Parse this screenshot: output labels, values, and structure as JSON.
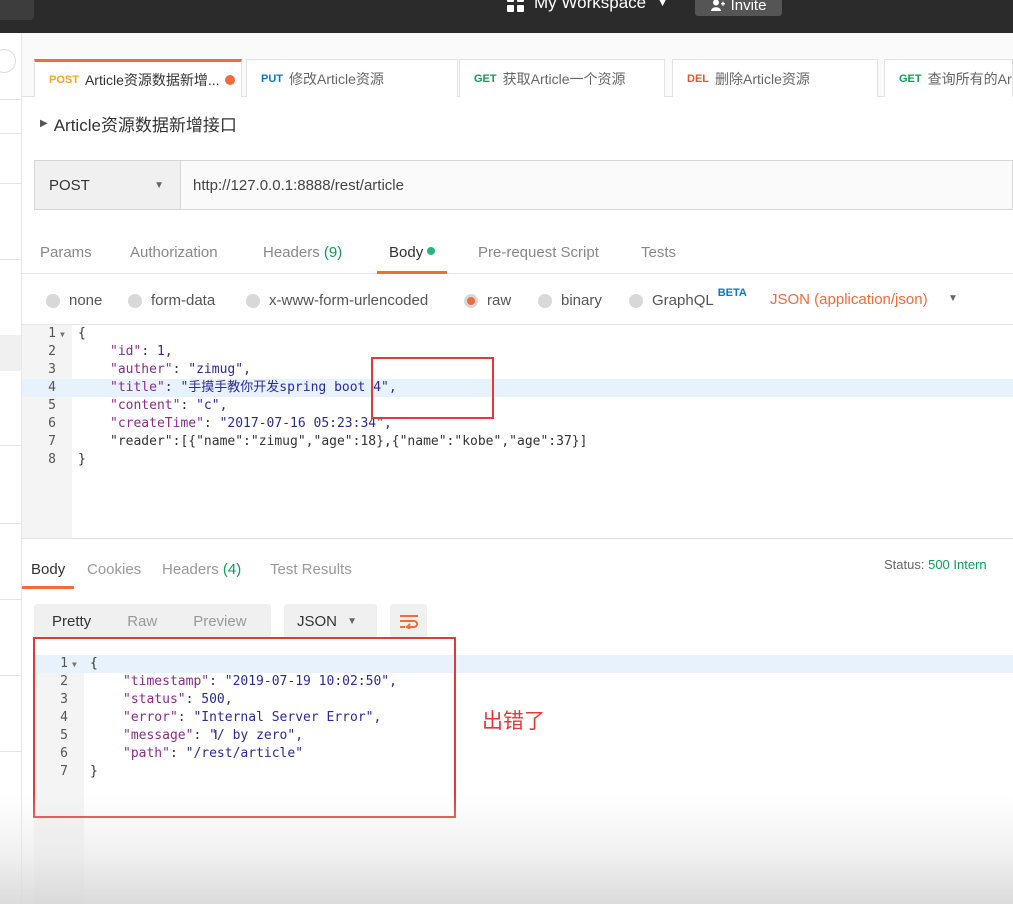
{
  "topbar": {
    "workspace": "My Workspace",
    "invite": "Invite"
  },
  "request_tabs": [
    {
      "method": "POST",
      "label": "Article资源数据新增..."
    },
    {
      "method": "PUT",
      "label": "修改Article资源"
    },
    {
      "method": "GET",
      "label": "获取Article一个资源"
    },
    {
      "method": "DEL",
      "label": "删除Article资源"
    },
    {
      "method": "GET",
      "label": "查询所有的Art"
    }
  ],
  "request": {
    "name": "Article资源数据新增接口",
    "method": "POST",
    "url": "http://127.0.0.1:8888/rest/article"
  },
  "subtabs": {
    "params": "Params",
    "authorization": "Authorization",
    "headers": "Headers",
    "headers_count": "(9)",
    "body": "Body",
    "prerequest": "Pre-request Script",
    "tests": "Tests"
  },
  "body_types": {
    "none": "none",
    "form_data": "form-data",
    "urlencoded": "x-www-form-urlencoded",
    "raw": "raw",
    "binary": "binary",
    "graphql": "GraphQL",
    "beta": "BETA",
    "json_type": "JSON (application/json)"
  },
  "request_body": {
    "line_numbers": [
      "1",
      "2",
      "3",
      "4",
      "5",
      "6",
      "7",
      "8"
    ],
    "open": "{",
    "id_key": "\"id\"",
    "id_val": "1,",
    "auther_key": "\"auther\"",
    "auther_val": "\"zimug\",",
    "title_key": "\"title\"",
    "title_val": "\"手摸手教你开发spring boot 4\",",
    "content_key": "\"content\"",
    "content_val": "\"c\",",
    "createTime_key": "\"createTime\"",
    "createTime_val": "\"2017-07-16 05:23:34\",",
    "reader_line": "\"reader\":[{\"name\":\"zimug\",\"age\":18},{\"name\":\"kobe\",\"age\":37}]",
    "close": "}"
  },
  "response_tabs": {
    "body": "Body",
    "cookies": "Cookies",
    "headers": "Headers",
    "headers_count": "(4)",
    "test_results": "Test Results"
  },
  "status": {
    "label": "Status:",
    "value": "500 Intern"
  },
  "view": {
    "pretty": "Pretty",
    "raw": "Raw",
    "preview": "Preview",
    "format": "JSON"
  },
  "response_body": {
    "line_numbers": [
      "1",
      "2",
      "3",
      "4",
      "5",
      "6",
      "7"
    ],
    "open": "{",
    "timestamp_key": "\"timestamp\"",
    "timestamp_val": "\"2019-07-19 10:02:50\",",
    "status_key": "\"status\"",
    "status_val": "500,",
    "error_key": "\"error\"",
    "error_val": "\"Internal Server Error\",",
    "message_key": "\"message\"",
    "message_val": "\"/ by zero\",",
    "path_key": "\"path\"",
    "path_val": "\"/rest/article\"",
    "close": "}"
  },
  "annotation": "出错了",
  "colors": {
    "accent": "#f26b3a",
    "annotation_red": "#e53935",
    "status_green": "#0f9d58"
  }
}
